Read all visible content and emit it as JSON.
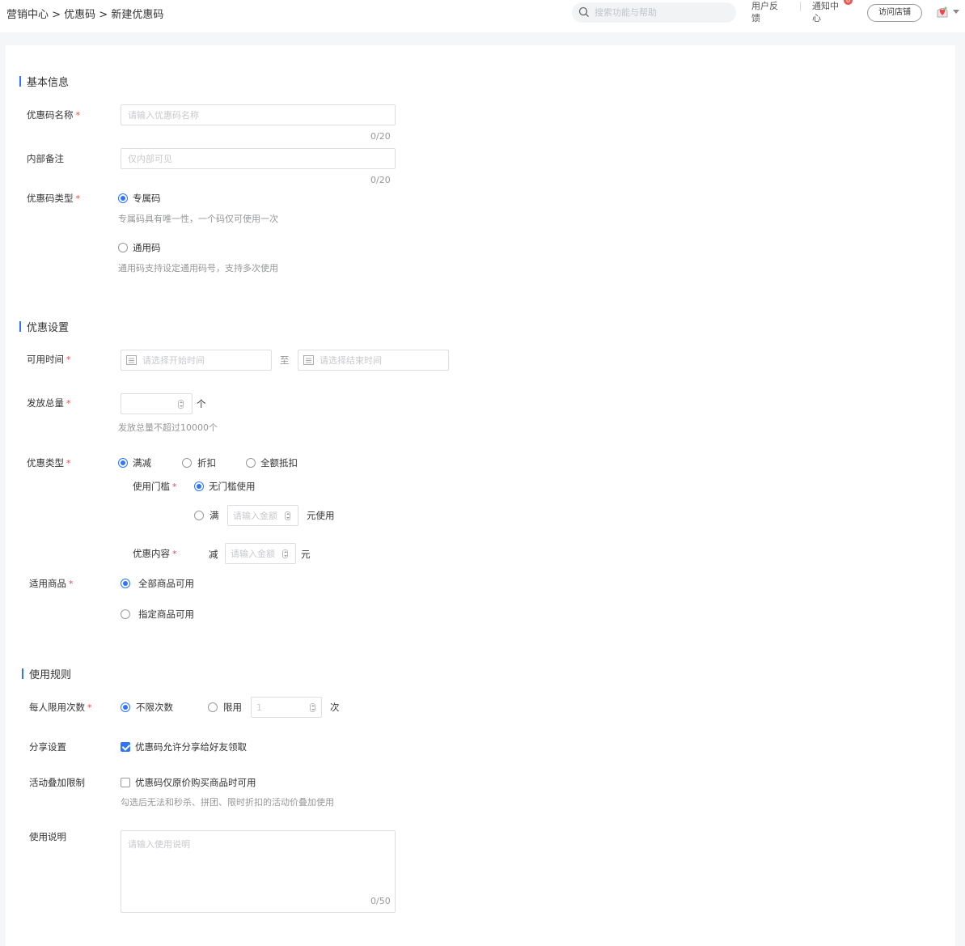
{
  "header": {
    "breadcrumb": "营销中心 > 优惠码 > 新建优惠码",
    "search_placeholder": "搜索功能与帮助",
    "feedback_label": "用户反馈",
    "notice_label": "通知中心",
    "notice_badge": "0",
    "visit_store_label": "访问店铺",
    "accent_color": "#2e74ff"
  },
  "basic": {
    "section_title": "基本信息",
    "name_label": "优惠码名称",
    "name_placeholder": "请输入优惠码名称",
    "name_counter": "0/20",
    "note_label": "内部备注",
    "note_placeholder": "仅内部可见",
    "note_counter": "0/20",
    "type_label": "优惠码类型",
    "type_exclusive": "专属码",
    "type_exclusive_hint": "专属码具有唯一性，一个码仅可使用一次",
    "type_general": "通用码",
    "type_general_hint": "通用码支持设定通用码号，支持多次使用",
    "type_selected": "专属码"
  },
  "discount": {
    "section_title": "优惠设置",
    "time_label": "可用时间",
    "start_placeholder": "请选择开始时间",
    "to_label": "至",
    "end_placeholder": "请选择结束时间",
    "total_label": "发放总量",
    "total_unit": "个",
    "total_hint": "发放总量不超过10000个",
    "kind_label": "优惠类型",
    "kind_full_reduce": "满减",
    "kind_discount": "折扣",
    "kind_full_deduct": "全额抵扣",
    "kind_selected": "满减",
    "threshold_label": "使用门槛",
    "threshold_none": "无门槛使用",
    "threshold_full": "满",
    "threshold_amount_placeholder": "请输入金额",
    "threshold_suffix": "元使用",
    "content_label": "优惠内容",
    "content_prefix": "减",
    "content_amount_placeholder": "请输入金额",
    "content_suffix": "元",
    "goods_label": "适用商品",
    "goods_all": "全部商品可用",
    "goods_specific": "指定商品可用",
    "goods_selected": "全部商品可用"
  },
  "rules": {
    "section_title": "使用规则",
    "limit_label": "每人限用次数",
    "limit_unlimited": "不限次数",
    "limit_limited": "限用",
    "limit_value_placeholder": "1",
    "limit_unit": "次",
    "share_label": "分享设置",
    "share_option": "优惠码允许分享给好友领取",
    "share_checked": true,
    "stack_label": "活动叠加限制",
    "stack_option": "优惠码仅原价购买商品时可用",
    "stack_hint": "勾选后无法和秒杀、拼团、限时折扣的活动价叠加使用",
    "stack_checked": false,
    "desc_label": "使用说明",
    "desc_placeholder": "请输入使用说明",
    "desc_counter": "0/50"
  }
}
